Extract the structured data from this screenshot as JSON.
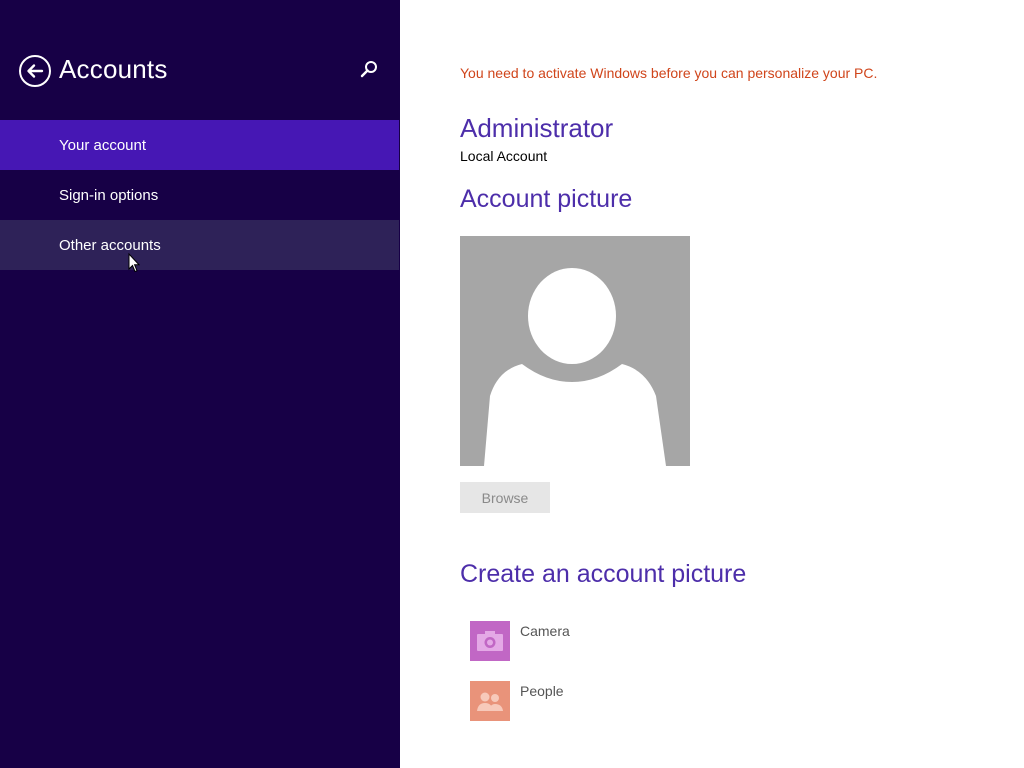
{
  "sidebar": {
    "title": "Accounts",
    "back_icon": "back-arrow-icon",
    "search_icon": "search-icon",
    "items": [
      {
        "label": "Your account",
        "state": "selected"
      },
      {
        "label": "Sign-in options",
        "state": "normal"
      },
      {
        "label": "Other accounts",
        "state": "hover"
      }
    ]
  },
  "main": {
    "activation_warning": "You need to activate Windows before you can personalize your PC.",
    "user_name": "Administrator",
    "account_type": "Local Account",
    "account_picture_title": "Account picture",
    "avatar_icon": "default-user-silhouette-icon",
    "browse_label": "Browse",
    "create_title": "Create an account picture",
    "apps": [
      {
        "label": "Camera",
        "icon": "camera-icon",
        "color": "#c167c5"
      },
      {
        "label": "People",
        "icon": "people-icon",
        "color": "#e9937a"
      }
    ]
  },
  "colors": {
    "sidebar_bg": "#170046",
    "selected_bg": "#4617b4",
    "hover_bg": "#2e2258",
    "accent_text": "#4d2eaa",
    "warning_text": "#d0451b"
  }
}
